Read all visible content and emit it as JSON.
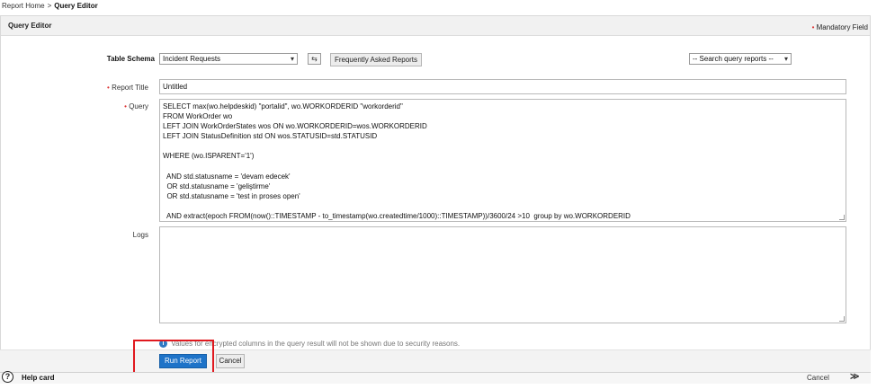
{
  "breadcrumb": {
    "home": "Report Home",
    "separator": ">",
    "current": "Query Editor"
  },
  "panel": {
    "title": "Query Editor"
  },
  "mandatory": {
    "star": "•",
    "label": "Mandatory Field"
  },
  "table_schema": {
    "label": "Table Schema",
    "selected": "Incident Requests",
    "icon": "columns-toggle-icon",
    "faq_button": "Frequently Asked Reports",
    "search_reports_placeholder": "-- Search query reports --"
  },
  "report_title": {
    "star": "•",
    "label": "Report Title",
    "value": "Untitled"
  },
  "query": {
    "star": "•",
    "label": "Query",
    "lines": [
      "SELECT max(wo.helpdeskid) \"portalid\", wo.WORKORDERID \"workorderid\"",
      "FROM WorkOrder wo",
      "LEFT JOIN WorkOrderStates wos ON wo.WORKORDERID=wos.WORKORDERID",
      "LEFT JOIN StatusDefinition std ON wos.STATUSID=std.STATUSID",
      "",
      "WHERE (wo.ISPARENT='1')",
      "",
      "  AND std.statusname = 'devam edecek'",
      "  OR std.statusname = 'geliştirme'",
      "  OR std.statusname = 'test in proses open'",
      "",
      "  AND extract(epoch FROM(now()::TIMESTAMP - to_timestamp(wo.createdtime/1000)::TIMESTAMP))/3600/24 >10  group by wo.WORKORDERID"
    ]
  },
  "logs": {
    "label": "Logs",
    "value": ""
  },
  "info": {
    "icon": "info-icon",
    "glyph": "i",
    "text": "Values for encrypted columns in the query result will not be shown due to security reasons."
  },
  "actions": {
    "run": "Run Report",
    "cancel": "Cancel"
  },
  "help_card": {
    "icon": "help-circle-icon",
    "glyph": "?",
    "label": "Help card",
    "cancel": "Cancel",
    "chevrons": "≫"
  },
  "colors": {
    "primary": "#1e73c8",
    "highlight": "#e0191f",
    "required": "#d33333"
  }
}
